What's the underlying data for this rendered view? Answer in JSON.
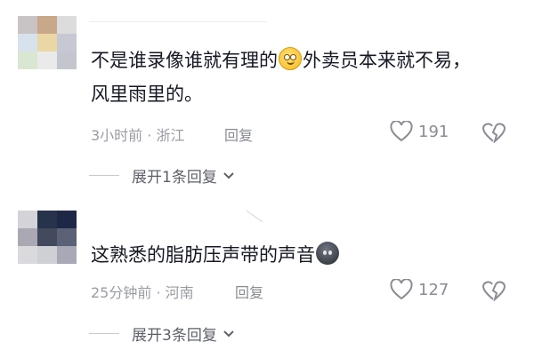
{
  "comments": [
    {
      "text_before": "不是谁录像谁就有理的",
      "emoji": "smile-emoji",
      "text_after": "外卖员本来就不易，风里雨里的。",
      "time_location": "3小时前 · 浙江",
      "reply_label": "回复",
      "likes": "191",
      "expand_label": "展开1条回复"
    },
    {
      "text_before": "这熟悉的脂肪压声带的声音",
      "emoji": "dark-face-emoji",
      "text_after": "",
      "time_location": "25分钟前 · 河南",
      "reply_label": "回复",
      "likes": "127",
      "expand_label": "展开3条回复"
    }
  ],
  "colors": {
    "text": "#161823",
    "meta": "#9a9ca3",
    "icon": "#8a8c93"
  }
}
